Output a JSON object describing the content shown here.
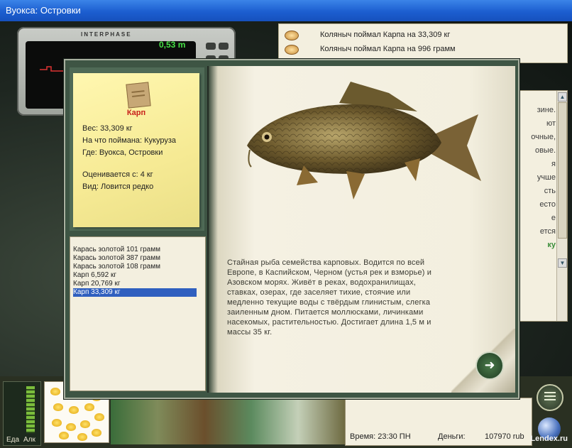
{
  "window": {
    "title": "Вуокса: Островки"
  },
  "sonar": {
    "brand": "INTERPHASE",
    "depth": "0,53 m"
  },
  "catch_log": [
    {
      "text": "Коляныч поймал Карпа на 33,309 кг"
    },
    {
      "text": "Коляныч поймал Карпа на 996 грамм"
    }
  ],
  "side_panel": {
    "lines": [
      "зине.",
      "ют",
      "очные,",
      "овые.",
      "я",
      "учше",
      "сть",
      "есто",
      "е",
      "ется"
    ],
    "link": "ку"
  },
  "fish_card": {
    "name": "Карп",
    "weight": "Вес: 33,309 кг",
    "bait": "На что поймана: Кукуруза",
    "place": "Где: Вуокса, Островки",
    "value": "Оценивается с: 4 кг",
    "type": "Вид: Ловится редко"
  },
  "catch_list": [
    {
      "label": "Карась золотой 101 грамм",
      "selected": false
    },
    {
      "label": "Карась золотой 387 грамм",
      "selected": false
    },
    {
      "label": "Карась золотой 108 грамм",
      "selected": false
    },
    {
      "label": "Карп 6,592 кг",
      "selected": false
    },
    {
      "label": "Карп 20,769 кг",
      "selected": false
    },
    {
      "label": "Карп 33,309 кг",
      "selected": true
    }
  ],
  "description": "Стайная рыба семейства карповых. Водится по всей Европе, в Каспийском, Черном (устья рек и взморье) и Азовском морях. Живёт в реках, водохранилищах, ставках, озерах, где заселяет тихие, стоячие или медленно текущие воды с твёрдым глинистым, слегка заиленным дном. Питается моллюсками, личинками насекомых, растительностью. Достигает длина 1,5 м и массы 35 кг.",
  "bottom": {
    "food_label": "Еда",
    "alc_label": "Алк",
    "time": "Время: 23:30 ПН",
    "money_label": "Деньги:",
    "money_value": "107970 rub"
  },
  "watermark": "Lendex.ru",
  "colors": {
    "title_bar": "#1c5ed0",
    "selected_row": "#2f5fbf",
    "fish_name": "#c8201a",
    "panel_bg": "#f3efdf"
  },
  "icons": [
    "menu-icon",
    "globe-icon",
    "next-arrow-icon",
    "pin-icon"
  ]
}
